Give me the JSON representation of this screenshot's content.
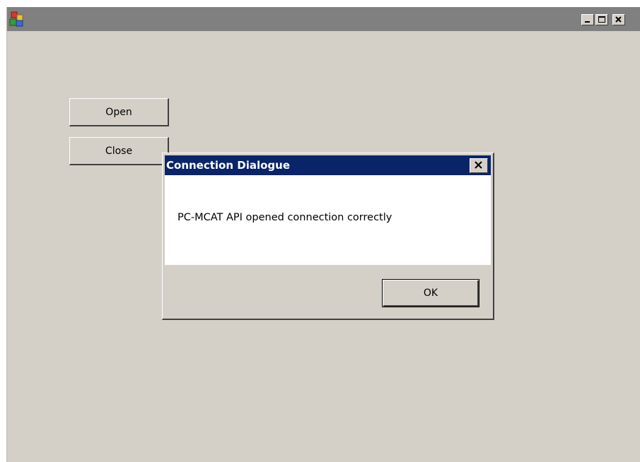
{
  "window": {
    "title": "",
    "icon": "app-blocks-icon",
    "controls": {
      "minimize": "minimize-icon",
      "maximize": "maximize-icon",
      "close": "close-icon"
    }
  },
  "form": {
    "open_label": "Open",
    "close_label": "Close"
  },
  "dialog": {
    "title": "Connection Dialogue",
    "message": "PC-MCAT API opened connection correctly",
    "ok_label": "OK",
    "close_icon": "close-icon"
  },
  "colors": {
    "window_bg": "#d4d0c8",
    "titlebar_inactive": "#808080",
    "dialog_titlebar": "#0a246a"
  }
}
